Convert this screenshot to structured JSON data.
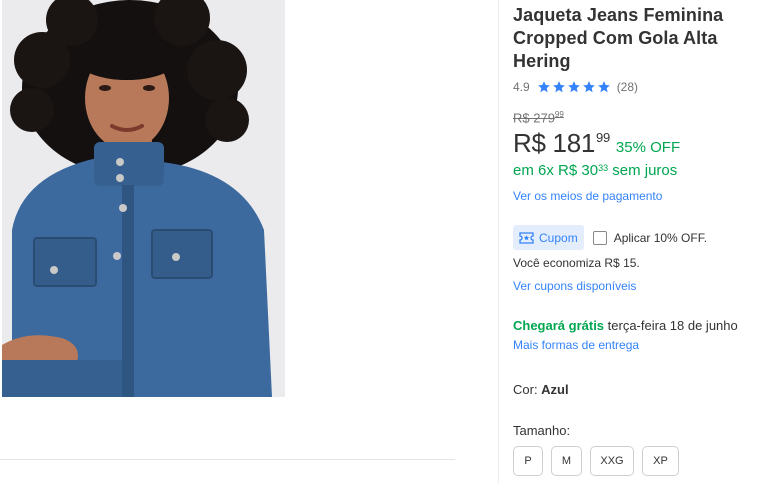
{
  "product": {
    "title": "Jaqueta Jeans Feminina Cropped Com Gola Alta Hering",
    "rating": {
      "score": "4.9",
      "stars": 5,
      "count": "(28)"
    },
    "old_price": {
      "main": "R$ 279",
      "cents": "99"
    },
    "price": {
      "main": "R$ 181",
      "cents": "99",
      "discount": "35% OFF"
    },
    "installments": {
      "prefix": "em ",
      "count": "6x",
      "amount": " R$ 30",
      "cents": "33",
      "suffix": " sem juros"
    },
    "payment_link": "Ver os meios de pagamento"
  },
  "coupon": {
    "badge": "Cupom",
    "apply_label": "Aplicar 10% OFF.",
    "savings": "Você economiza R$ 15.",
    "link": "Ver cupons disponíveis"
  },
  "shipping": {
    "free_label": "Chegará grátis",
    "date": " terça-feira 18 de junho",
    "link": "Mais formas de entrega"
  },
  "variation": {
    "color_label": "Cor: ",
    "color_value": "Azul",
    "size_label": "Tamanho:",
    "sizes": [
      "P",
      "M",
      "XXG",
      "XP"
    ]
  },
  "colors": {
    "accent": "#3483fa",
    "green": "#00a650",
    "text": "#333333",
    "muted": "#737373"
  }
}
